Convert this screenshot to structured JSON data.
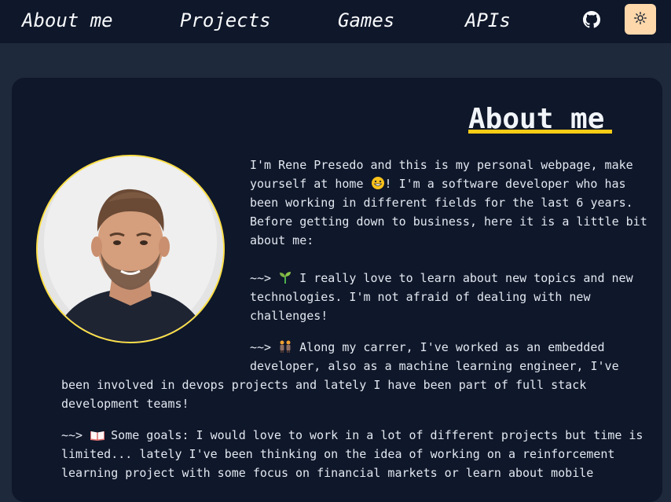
{
  "nav": {
    "links": [
      "About me",
      "Projects",
      "Games",
      "APIs"
    ],
    "github_icon": "github-icon",
    "theme_icon": "sun-icon"
  },
  "colors": {
    "page_bg": "#1e293b",
    "nav_bg": "#0f172a",
    "card_bg": "#0f172a",
    "accent_yellow": "#facc15",
    "toggle_bg": "#fed7aa"
  },
  "about": {
    "title": "About me",
    "intro": [
      "I'm Rene Presedo and this is my personal webpage, make",
      "yourself at home ",
      "! I'm a software developer who has",
      "been working in different fields for the last 6 years.",
      "Before getting down to business, here it is a little bit",
      "about me:"
    ],
    "arrow": "~~>",
    "point1": [
      " I really love to learn about new topics and new",
      "technologies. I'm not afraid of dealing with new",
      "challenges!"
    ],
    "point2": [
      " Along my carrer, I've worked as an embedded",
      "developer, also as a machine learning engineer, I've",
      "been involved in devops projects and lately I have been part of full stack",
      "development teams!"
    ],
    "point3": [
      " Some goals: I would love to work in a lot of different projects but time is",
      "limited... lately I've been thinking on the idea of working on a reinforcement",
      "learning project with some focus on financial markets or learn about mobile"
    ],
    "emojis": [
      "grinning-face-icon",
      "seedling-icon",
      "two-people-icon",
      "open-book-icon"
    ]
  }
}
